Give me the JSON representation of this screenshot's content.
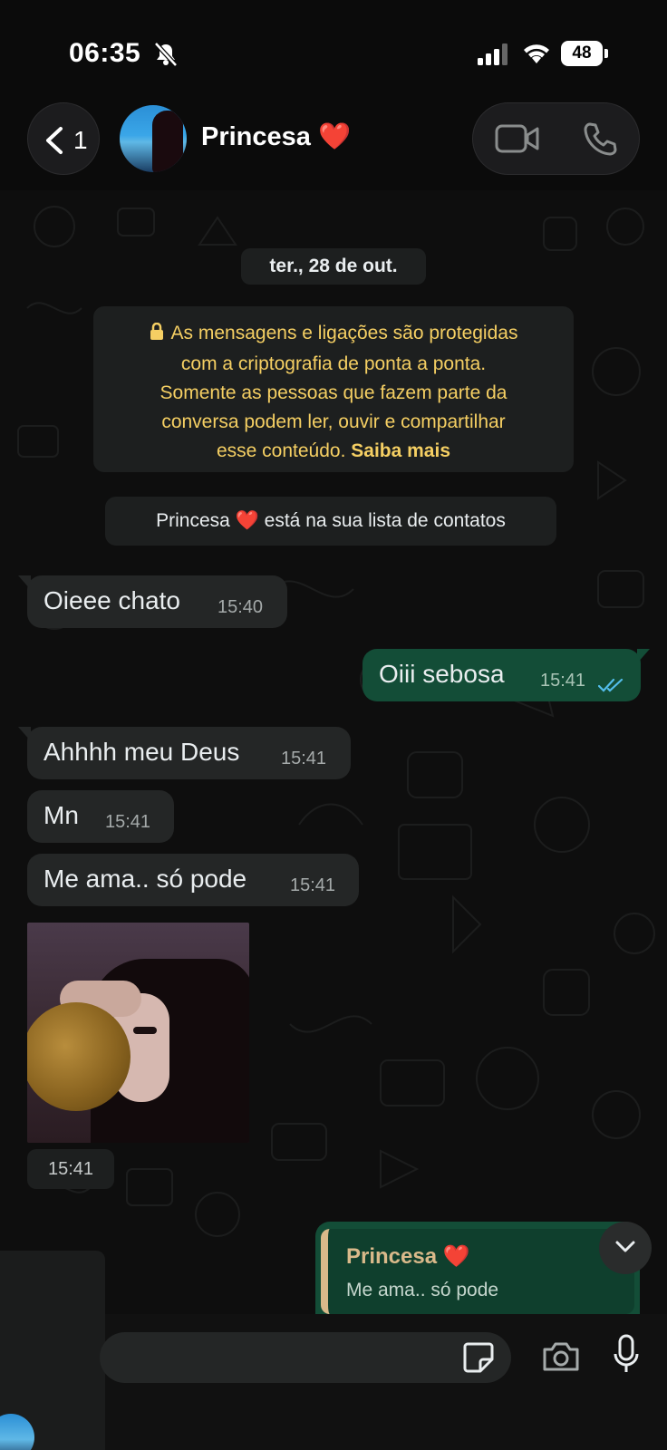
{
  "status_bar": {
    "time": "06:35",
    "battery": "48"
  },
  "header": {
    "back_count": "1",
    "contact_name": "Princesa ❤️"
  },
  "chat": {
    "date": "ter., 28 de out.",
    "encryption": {
      "lines": [
        "As mensagens e ligações são protegidas",
        "com a criptografia de ponta a ponta.",
        "Somente as pessoas que fazem parte da",
        "conversa podem ler, ouvir e compartilhar"
      ],
      "last_line": "esse conteúdo.",
      "learn_more": "Saiba mais"
    },
    "contact_note": "Princesa ❤️  está na sua lista de contatos",
    "messages": [
      {
        "direction": "in",
        "text": "Oieee chato",
        "time": "15:40"
      },
      {
        "direction": "out",
        "text": "Oiii sebosa",
        "time": "15:41",
        "status": "read"
      },
      {
        "direction": "in",
        "text": "Ahhhh meu Deus",
        "time": "15:41"
      },
      {
        "direction": "in",
        "text": "Mn",
        "time": "15:41"
      },
      {
        "direction": "in",
        "text": "Me ama.. só pode",
        "time": "15:41"
      }
    ],
    "photo_time": "15:41",
    "reply": {
      "name": "Princesa ❤️",
      "quoted_text": "Me ama.. só pode"
    }
  },
  "composer": {
    "placeholder": ""
  },
  "colors": {
    "outgoing_bubble": "#134d37",
    "incoming_bubble": "#242626",
    "system_text": "#f5cf63",
    "read_ticks": "#53bdeb"
  },
  "icons": [
    "bell-slash-icon",
    "signal-icon",
    "wifi-icon",
    "chevron-left-icon",
    "video-call-icon",
    "phone-icon",
    "lock-icon",
    "double-check-icon",
    "chevron-down-icon",
    "sticker-icon",
    "camera-icon",
    "mic-icon"
  ]
}
